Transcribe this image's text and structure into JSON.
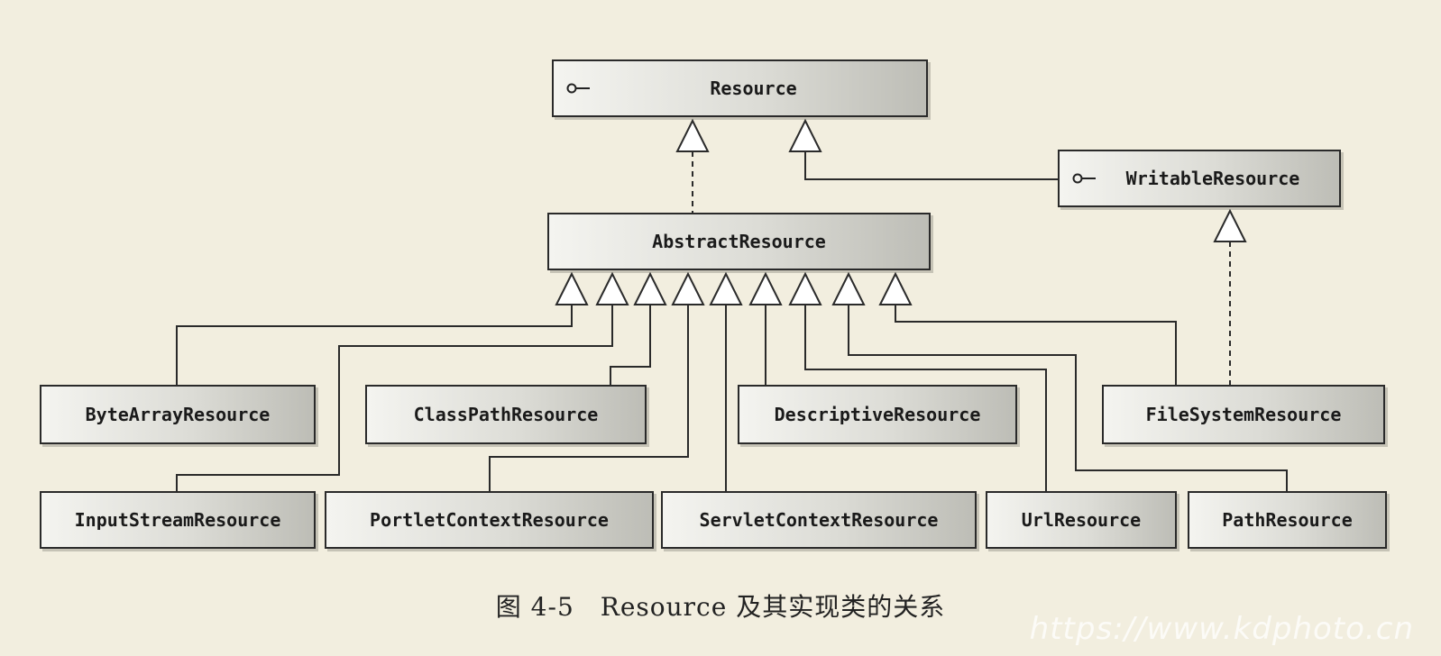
{
  "classes": {
    "resource": "Resource",
    "writable_resource": "WritableResource",
    "abstract_resource": "AbstractResource",
    "byte_array_resource": "ByteArrayResource",
    "class_path_resource": "ClassPathResource",
    "descriptive_resource": "DescriptiveResource",
    "file_system_resource": "FileSystemResource",
    "input_stream_resource": "InputStreamResource",
    "portlet_context_resource": "PortletContextResource",
    "servlet_context_resource": "ServletContextResource",
    "url_resource": "UrlResource",
    "path_resource": "PathResource"
  },
  "caption": "图 4-5　Resource 及其实现类的关系",
  "watermark": "https://www.kdphoto.cn",
  "colors": {
    "background": "#f2eedf",
    "line": "#2a2a2a"
  }
}
